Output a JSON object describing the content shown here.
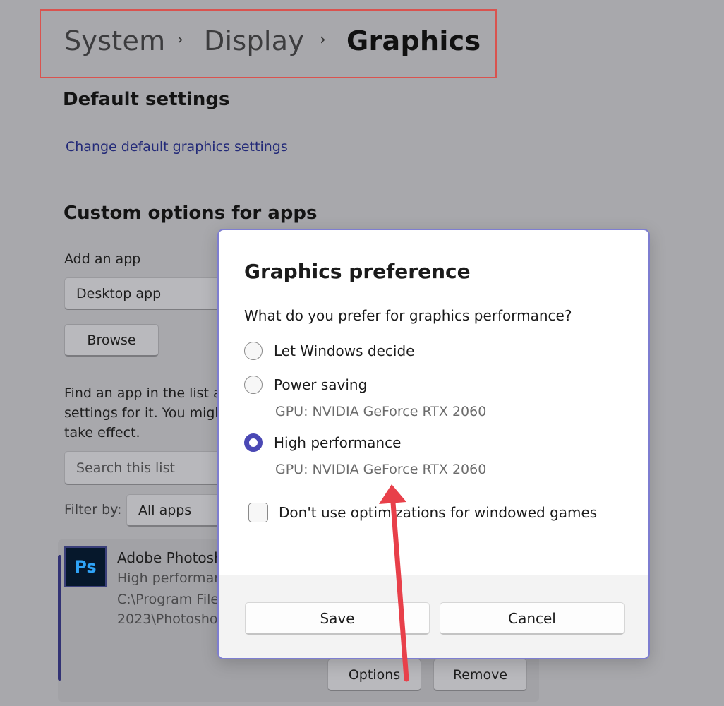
{
  "breadcrumb": {
    "items": [
      "System",
      "Display",
      "Graphics"
    ],
    "separator": "›"
  },
  "default_settings": {
    "heading": "Default settings",
    "link": "Change default graphics settings"
  },
  "custom_options": {
    "heading": "Custom options for apps",
    "add_app_label": "Add an app",
    "app_type_value": "Desktop app",
    "browse_label": "Browse",
    "help_lines": [
      "Find an app in the list a",
      "settings for it. You migh",
      "take effect."
    ],
    "search_placeholder": "Search this list",
    "filter_label": "Filter by:",
    "filter_value": "All apps"
  },
  "app_entry": {
    "icon_text": "Ps",
    "name": "Adobe Photosh",
    "preference": "High performan",
    "path_line1": "C:\\Program File",
    "path_line2": "2023\\Photosho",
    "options_label": "Options",
    "remove_label": "Remove"
  },
  "dialog": {
    "title": "Graphics preference",
    "question": "What do you prefer for graphics performance?",
    "options": [
      {
        "label": "Let Windows decide",
        "gpu": "",
        "selected": false
      },
      {
        "label": "Power saving",
        "gpu": "GPU: NVIDIA GeForce RTX 2060",
        "selected": false
      },
      {
        "label": "High performance",
        "gpu": "GPU: NVIDIA GeForce RTX 2060",
        "selected": true
      }
    ],
    "checkbox_label": "Don't use optimizations for windowed games",
    "checkbox_checked": false,
    "save_label": "Save",
    "cancel_label": "Cancel"
  },
  "colors": {
    "highlight_box": "#d9534f",
    "accent": "#4a48b4",
    "annotation_arrow": "#e8404a"
  }
}
